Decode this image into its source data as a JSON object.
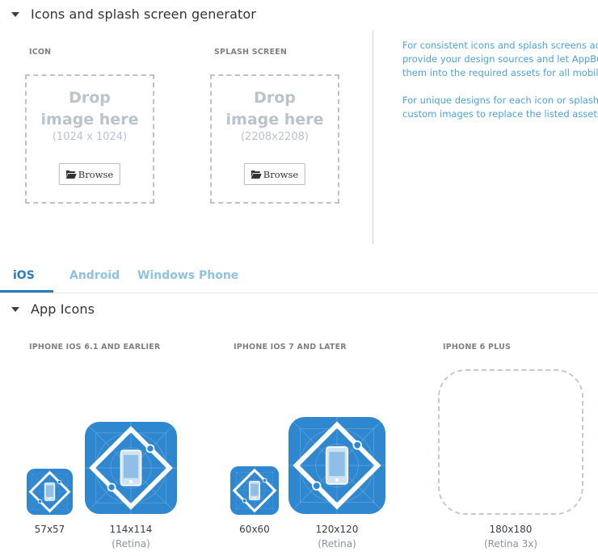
{
  "generator": {
    "title": "Icons and splash screen generator",
    "icon_label": "ICON",
    "splash_label": "SPLASH SCREEN",
    "drop_line1": "Drop",
    "drop_line2": "image here",
    "icon_size": "(1024 x 1024)",
    "splash_size": "(2208x2208)",
    "browse_label": "Browse",
    "help_p1": [
      "For consistent icons and splash screens acr",
      "provide your design sources and let AppBu",
      "them into the required assets for all mobile"
    ],
    "help_p2": [
      "For unique designs for each icon or splash s",
      "custom images to replace the listed assets c"
    ]
  },
  "tabs": [
    {
      "label": "iOS",
      "active": true
    },
    {
      "label": "Android",
      "active": false
    },
    {
      "label": "Windows Phone",
      "active": false
    }
  ],
  "app_icons": {
    "title": "App Icons",
    "groups": [
      {
        "label": "IPHONE IOS 6.1 AND EARLIER"
      },
      {
        "label": "IPHONE IOS 7 AND LATER"
      },
      {
        "label": "IPHONE 6 PLUS"
      }
    ],
    "sizes": {
      "s57": "57x57",
      "s114": "114x114",
      "s60": "60x60",
      "s120": "120x120",
      "s180": "180x180"
    },
    "retina": "(Retina)",
    "retina3x": "(Retina 3x)"
  },
  "colors": {
    "accent": "#2b7bbf",
    "icon_blue": "#2f87d0",
    "tab_inactive": "#8fc1e0",
    "help_text": "#4da3d6"
  },
  "icons": [
    "caret-down-icon",
    "folder-open-icon",
    "app-icon-artwork"
  ]
}
